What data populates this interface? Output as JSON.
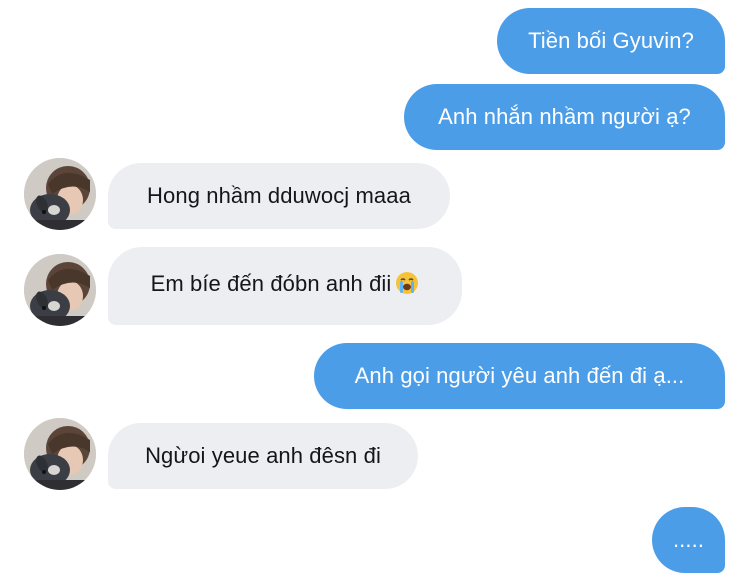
{
  "conversation": {
    "messages": [
      {
        "direction": "outgoing",
        "text": "Tiền bối Gyuvin?"
      },
      {
        "direction": "outgoing",
        "text": "Anh nhắn nhầm người ạ?"
      },
      {
        "direction": "incoming",
        "text": "Hong nhầm dduwocj maaa",
        "avatar": "avatar-photo"
      },
      {
        "direction": "incoming",
        "text": "Em bíe đến đóbn anh đii",
        "emoji": "loudly-crying-face-icon",
        "avatar": "avatar-photo"
      },
      {
        "direction": "outgoing",
        "text": "Anh gọi người yêu anh đến đi ạ..."
      },
      {
        "direction": "incoming",
        "text": "Ngừoi yeue anh đêsn đi",
        "avatar": "avatar-photo"
      },
      {
        "direction": "outgoing",
        "text": "....."
      }
    ]
  },
  "colors": {
    "outgoing_bubble": "#4c9de8",
    "incoming_bubble": "#eceef1",
    "outgoing_text": "#ffffff",
    "incoming_text": "#14171a",
    "background": "#ffffff"
  }
}
